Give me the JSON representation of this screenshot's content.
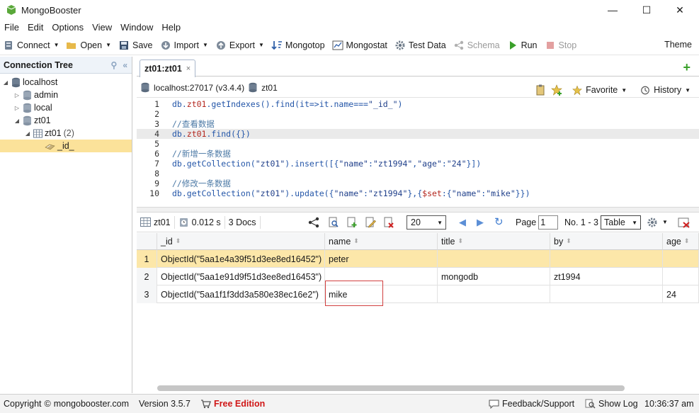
{
  "window": {
    "title": "MongoBooster",
    "controls": {
      "minimize": "—",
      "maximize": "☐",
      "close": "✕"
    }
  },
  "menu": [
    "File",
    "Edit",
    "Options",
    "View",
    "Window",
    "Help"
  ],
  "toolbar": {
    "connect": "Connect",
    "open": "Open",
    "save": "Save",
    "import": "Import",
    "export": "Export",
    "mongotop": "Mongotop",
    "mongostat": "Mongostat",
    "test_data": "Test Data",
    "schema": "Schema",
    "run": "Run",
    "stop": "Stop",
    "theme": "Theme"
  },
  "connection_tree": {
    "title": "Connection Tree",
    "nodes": {
      "localhost": "localhost",
      "admin": "admin",
      "local": "local",
      "zt01": "zt01",
      "collection": "zt01",
      "collection_count": "(2)",
      "index": "_id_"
    }
  },
  "tab": {
    "label": "zt01:zt01",
    "close": "×"
  },
  "connbar": {
    "server": "localhost:27017 (v3.4.4)",
    "database": "zt01",
    "favorite": "Favorite",
    "history": "History"
  },
  "editor": {
    "line_numbers": [
      "1",
      "2",
      "3",
      "4",
      "5",
      "6",
      "7",
      "8",
      "9",
      "10"
    ],
    "l1_a": "db.",
    "l1_b": "zt01",
    "l1_c": ".getIndexes().find(it=>it.name===",
    "l1_d": "\"_id_\"",
    "l1_e": ")",
    "l3": "//查看数据",
    "l4_a": "db.",
    "l4_b": "zt01",
    "l4_c": ".find({})",
    "l6": "//新增一条数据",
    "l7_a": "db.getCollection(",
    "l7_b": "\"zt01\"",
    "l7_c": ").insert([{",
    "l7_d": "\"name\"",
    "l7_e": ":",
    "l7_f": "\"zt1994\"",
    "l7_g": ",",
    "l7_h": "\"age\"",
    "l7_i": ":",
    "l7_j": "\"24\"",
    "l7_k": "}])",
    "l9": "//修改一条数据",
    "l10_a": "db.getCollection(",
    "l10_b": "\"zt01\"",
    "l10_c": ").update({",
    "l10_d": "\"name\"",
    "l10_e": ":",
    "l10_f": "\"zt1994\"",
    "l10_g": "},{",
    "l10_h": "$set",
    "l10_i": ":{",
    "l10_j": "\"name\"",
    "l10_k": ":",
    "l10_l": "\"mike\"",
    "l10_m": "}})"
  },
  "results": {
    "collection": "zt01",
    "time": "0.012 s",
    "docs": "3 Docs",
    "page_size": "20",
    "page_label": "Page",
    "page_value": "1",
    "range": "No. 1 - 3",
    "view_mode": "Table"
  },
  "grid": {
    "columns": [
      "_id",
      "name",
      "title",
      "by",
      "age"
    ],
    "rows": [
      {
        "num": "1",
        "id": "ObjectId(\"5aa1e4a39f51d3ee8ed16452\")",
        "name": "peter",
        "title": "",
        "by": "",
        "age": ""
      },
      {
        "num": "2",
        "id": "ObjectId(\"5aa1e91d9f51d3ee8ed16453\")",
        "name": "",
        "title": "mongodb",
        "by": "zt1994",
        "age": ""
      },
      {
        "num": "3",
        "id": "ObjectId(\"5aa1f1f3dd3a580e38ec16e2\")",
        "name": "mike",
        "title": "",
        "by": "",
        "age": "24"
      }
    ]
  },
  "status": {
    "copyright": "Copyright",
    "site": "mongobooster.com",
    "version": "Version 3.5.7",
    "edition": "Free Edition",
    "feedback": "Feedback/Support",
    "show_log": "Show Log",
    "time": "10:36:37 am"
  },
  "colors": {
    "selection": "#fce7a9",
    "tree_selection": "#fbe29a",
    "accent_green": "#3aa02a",
    "free_edition": "#d01616"
  }
}
